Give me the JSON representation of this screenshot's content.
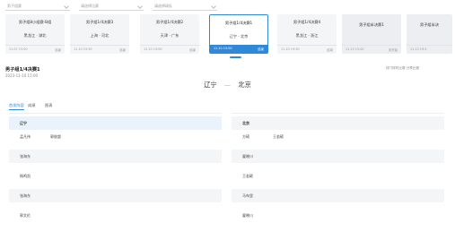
{
  "filters": [
    {
      "label": "男子组赛"
    },
    {
      "label": "请选择比赛"
    },
    {
      "label": "请选择球队"
    }
  ],
  "cards": [
    {
      "round": "男子组8小组赛-B组",
      "teams": "黑龙江 · 湖北",
      "time": "11.07 15:00",
      "status": "结束"
    },
    {
      "round": "男子组1/4决赛3",
      "teams": "上海 · 河北",
      "time": "11.10 19:30",
      "status": "结束"
    },
    {
      "round": "男子组1/4决赛2",
      "teams": "天津 · 广东",
      "time": "11.10 15:00",
      "status": "结束"
    },
    {
      "round": "男子组1/4决赛1",
      "teams": "辽宁 · 北京",
      "time": "11.10 15:00",
      "status": "结束"
    },
    {
      "round": "男子组1/4决赛4",
      "teams": "黑龙江 · 浙江",
      "time": "11.10 19:30",
      "status": "结束"
    },
    {
      "round": "男子组半决赛1",
      "teams": "",
      "time": "11.13 15:00",
      "status": "未开始"
    },
    {
      "round": "男子组半决",
      "teams": "",
      "time": "11.13 19:3",
      "status": ""
    }
  ],
  "match": {
    "title": "男子组1/4决赛1",
    "date": "2023-11-10 15:00",
    "share": "排门球时比赛 分享比赛",
    "home": "辽宁",
    "away": "北京",
    "separator": "—"
  },
  "tabs": [
    "首发阵容",
    "成绩",
    "图表"
  ],
  "left_table": [
    {
      "c1": "辽宁",
      "c2": ""
    },
    {
      "c1": "孟凡伟",
      "c2": "郭俊超"
    },
    {
      "c1": "张海东",
      "c2": ""
    },
    {
      "c1": "杨鸣凯",
      "c2": ""
    },
    {
      "c1": "张海东",
      "c2": ""
    },
    {
      "c1": "郭艾伦",
      "c2": ""
    }
  ],
  "right_table": [
    {
      "c1": "北京",
      "c2": ""
    },
    {
      "c1": "方硕",
      "c2": "王若砺"
    },
    {
      "c1": "翟晓川",
      "c2": ""
    },
    {
      "c1": "王若砺",
      "c2": ""
    },
    {
      "c1": "马布里",
      "c2": ""
    },
    {
      "c1": "翟晓川",
      "c2": ""
    }
  ],
  "colors": {
    "accent": "#2f88d8",
    "card_bg": "#f4f5f7",
    "row_shade": "#f4f5f7",
    "row_highlight": "#eaf2fc"
  }
}
